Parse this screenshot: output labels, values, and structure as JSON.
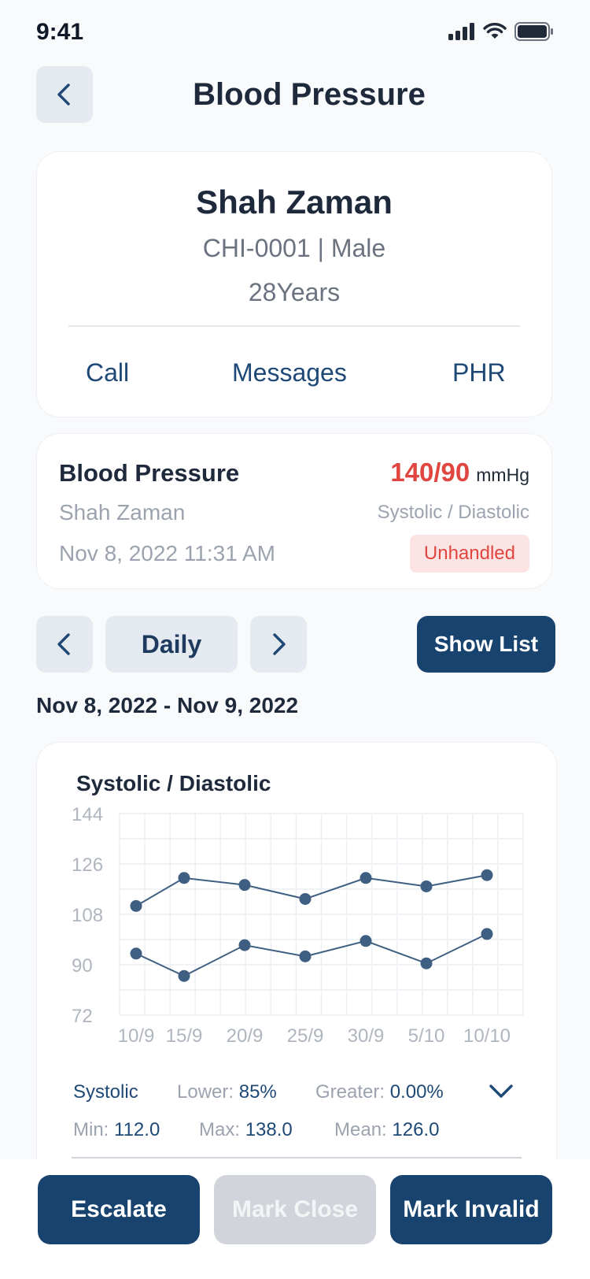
{
  "status_bar": {
    "time": "9:41"
  },
  "header": {
    "title": "Blood Pressure"
  },
  "patient": {
    "name": "Shah Zaman",
    "meta": "CHI-0001 | Male",
    "age": "28Years",
    "actions": [
      "Call",
      "Messages",
      "PHR"
    ]
  },
  "reading": {
    "title": "Blood Pressure",
    "patient_name": "Shah Zaman",
    "datetime": "Nov 8, 2022 11:31 AM",
    "value": "140/90",
    "unit": "mmHg",
    "sub_label": "Systolic / Diastolic",
    "status": "Unhandled",
    "status_color": "#e0463f"
  },
  "controls": {
    "period": "Daily",
    "show_list": "Show List"
  },
  "date_range": "Nov 8, 2022 - Nov 9, 2022",
  "chart_data": {
    "type": "line",
    "title": "Systolic / Diastolic",
    "categories": [
      "10/9",
      "15/9",
      "20/9",
      "25/9",
      "30/9",
      "5/10",
      "10/10"
    ],
    "yticks": [
      "144",
      "126",
      "108",
      "90",
      "72"
    ],
    "ylim": [
      72,
      144
    ],
    "grid": true,
    "series": [
      {
        "values": [
          111,
          121,
          118.5,
          113.5,
          121,
          118,
          122
        ],
        "color": "#3e5f82"
      },
      {
        "values": [
          94,
          86,
          97,
          93,
          98.5,
          90.5,
          101
        ],
        "color": "#3e5f82"
      }
    ]
  },
  "stats": {
    "name": "Systolic",
    "lower_label": "Lower:",
    "lower_value": "85%",
    "greater_label": "Greater:",
    "greater_value": "0.00%",
    "min_label": "Min:",
    "min_value": "112.0",
    "max_label": "Max:",
    "max_value": "138.0",
    "mean_label": "Mean:",
    "mean_value": "126.0"
  },
  "bottom_actions": {
    "escalate": "Escalate",
    "mark_close": "Mark Close",
    "mark_invalid": "Mark Invalid"
  },
  "colors": {
    "primary": "#17436e",
    "danger": "#e0463f",
    "muted": "#9ca3af"
  }
}
